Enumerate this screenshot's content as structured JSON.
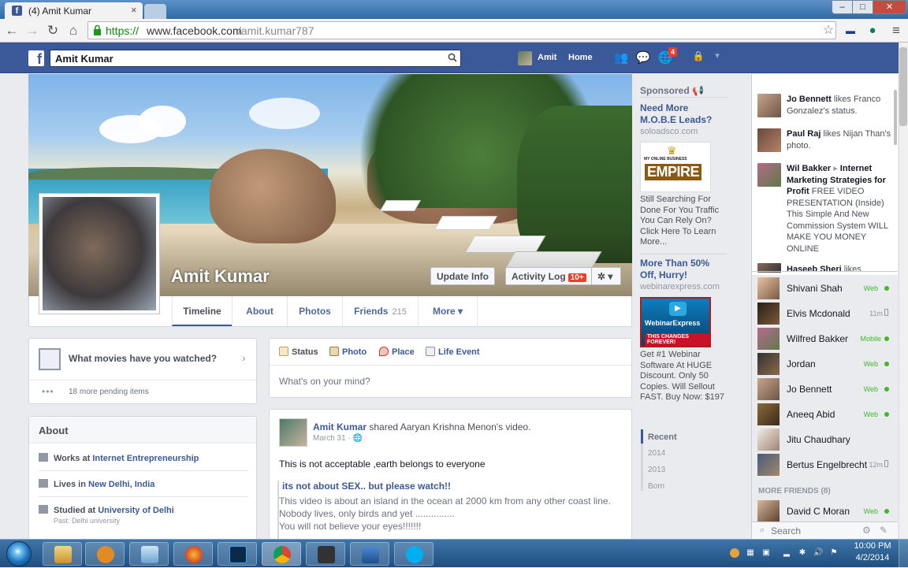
{
  "browser": {
    "tab_title": "(4) Amit Kumar",
    "tab_close": "×",
    "url_secure": "https://",
    "url_host": "www.facebook.com",
    "url_path": "/amit.kumar787",
    "window_min": "‒",
    "window_max": "□",
    "window_close": "✕"
  },
  "fb": {
    "logo": "f",
    "search_value": "Amit Kumar",
    "nav_name": "Amit",
    "nav_home": "Home",
    "notif_count": "4"
  },
  "profile": {
    "name": "Amit Kumar",
    "update_info": "Update Info",
    "activity_log": "Activity Log",
    "activity_badge": "10+",
    "settings_caret": "✲ ▾",
    "tabs": [
      {
        "label": "Timeline"
      },
      {
        "label": "About"
      },
      {
        "label": "Photos"
      },
      {
        "label": "Friends",
        "count": "215"
      },
      {
        "label": "More ▾"
      }
    ]
  },
  "movies": {
    "question": "What movies have you watched?",
    "chevron": "›",
    "dots": "•••",
    "pending": "18 more pending items"
  },
  "about": {
    "title": "About",
    "work_prefix": "Works at ",
    "work_link": "Internet Entrepreneurship",
    "lives_prefix": "Lives in ",
    "lives_link": "New Delhi, India",
    "study_prefix": "Studied at ",
    "study_link": "University of Delhi",
    "study_sub": "Past: Delhi university"
  },
  "composer": {
    "tabs": [
      "Status",
      "Photo",
      "Place",
      "Life Event"
    ],
    "placeholder": "What's on your mind?"
  },
  "post": {
    "author": "Amit Kumar",
    "action": " shared Aaryan Krishna Menon's video.",
    "date": "March 31 · 🌐",
    "text": "This is not acceptable ,earth belongs to everyone",
    "shared_title": "its not about SEX.. but please watch!!",
    "shared_desc_1": "This video is about an island in the ocean at 2000 km from any other coast line.",
    "shared_desc_2": "Nobody lives, only birds and yet ...............",
    "shared_desc_3": "You will not believe your eyes!!!!!!!"
  },
  "sponsored": {
    "title": "Sponsored 📢",
    "ads": [
      {
        "title": "Need More M.O.B.E Leads?",
        "domain": "soloadsco.com",
        "img_top": "MY ONLINE BUSINESS",
        "img_word": "EMPIRE",
        "body": "Still Searching For Done For You Traffic You Can Rely On? Click Here To Learn More..."
      },
      {
        "title": "More Than 50% Off, Hurry!",
        "domain": "webinarexpress.com",
        "img_word": "WebinarExpress",
        "img_banner": "THIS CHANGES FOREVER!",
        "body": "Get #1 Webinar Software At HUGE Discount. Only 50 Copies. Will Sellout FAST. Buy Now: $197"
      }
    ],
    "recent": [
      "Recent",
      "2014",
      "2013",
      "Born"
    ]
  },
  "ticker": [
    {
      "name": "Jo Bennett",
      "text": " likes Franco Gonzalez's status."
    },
    {
      "name": "Paul Raj",
      "text": " likes Nijan Than's photo."
    },
    {
      "name": "Wil Bakker",
      "arrow": " ▸ ",
      "target": "Internet Marketing Strategies for Profit",
      "text": " FREE VIDEO PRESENTATION (Inside) This Simple And New Commission System WILL MAKE YOU MONEY ONLINE"
    },
    {
      "name": "Haseeb Sheri",
      "text": " likes"
    }
  ],
  "chat": {
    "friends": [
      {
        "name": "Shivani Shah",
        "status": "Web"
      },
      {
        "name": "Elvis Mcdonald",
        "status": "11m"
      },
      {
        "name": "Wilfred Bakker",
        "status": "Mobile"
      },
      {
        "name": "Jordan",
        "status": "Web"
      },
      {
        "name": "Jo Bennett",
        "status": "Web"
      },
      {
        "name": "Aneeq Abid",
        "status": "Web"
      },
      {
        "name": "Jitu Chaudhary",
        "status": ""
      },
      {
        "name": "Bertus Engelbrecht",
        "status": "12m"
      }
    ],
    "more_friends": "MORE FRIENDS (8)",
    "extra": {
      "name": "David C Moran",
      "status": "Web"
    },
    "search_placeholder": "Search"
  },
  "taskbar": {
    "time": "10:00 PM",
    "date": "4/2/2014"
  }
}
